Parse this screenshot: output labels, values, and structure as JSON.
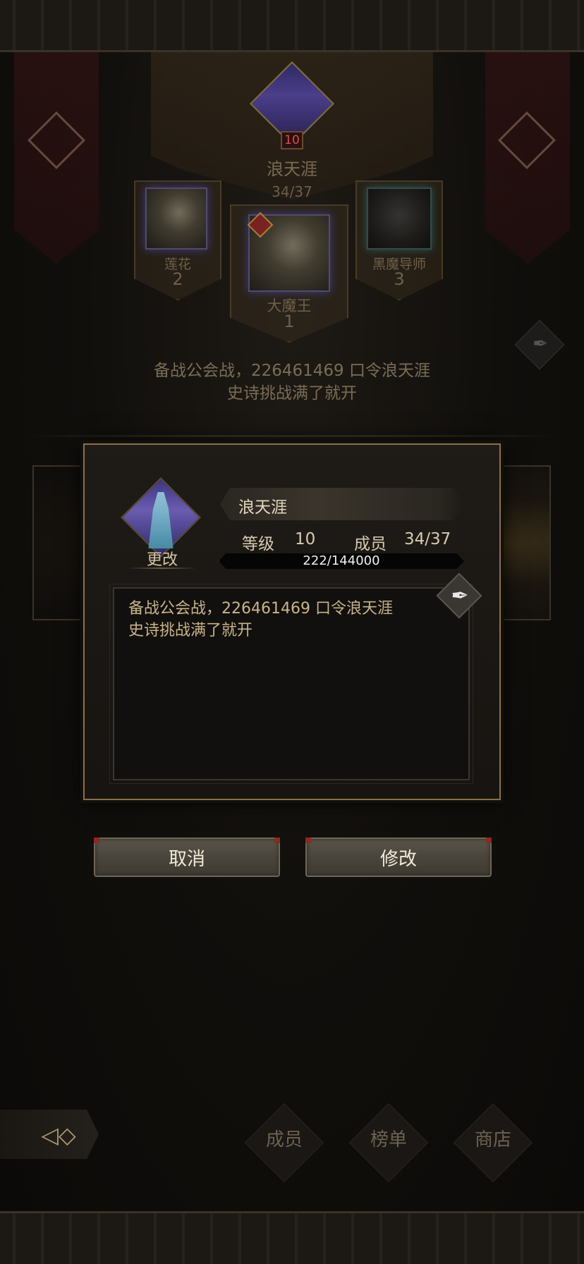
{
  "guild": {
    "level": "10",
    "name": "浪天涯",
    "members": "34/37"
  },
  "ranking": [
    {
      "name": "莲花",
      "rank": "2"
    },
    {
      "name": "大魔王",
      "rank": "1"
    },
    {
      "name": "黑魔导师",
      "rank": "3"
    }
  ],
  "notice": {
    "line1": "备战公会战，226461469 口令浪天涯",
    "line2": "史诗挑战满了就开"
  },
  "dialog": {
    "change_label": "更改",
    "name": "浪天涯",
    "level_label": "等级",
    "level_value": "10",
    "members_label": "成员",
    "members_value": "34/37",
    "exp_text": "222/144000",
    "exp_fraction": 0.0015,
    "announcement": "备战公会战，226461469 口令浪天涯\n史诗挑战满了就开",
    "cancel_label": "取消",
    "confirm_label": "修改"
  },
  "nav": {
    "members": "成员",
    "rankings": "榜单",
    "shop": "商店"
  },
  "icons": {
    "back": "back-arrow-icon",
    "edit": "quill-icon"
  }
}
